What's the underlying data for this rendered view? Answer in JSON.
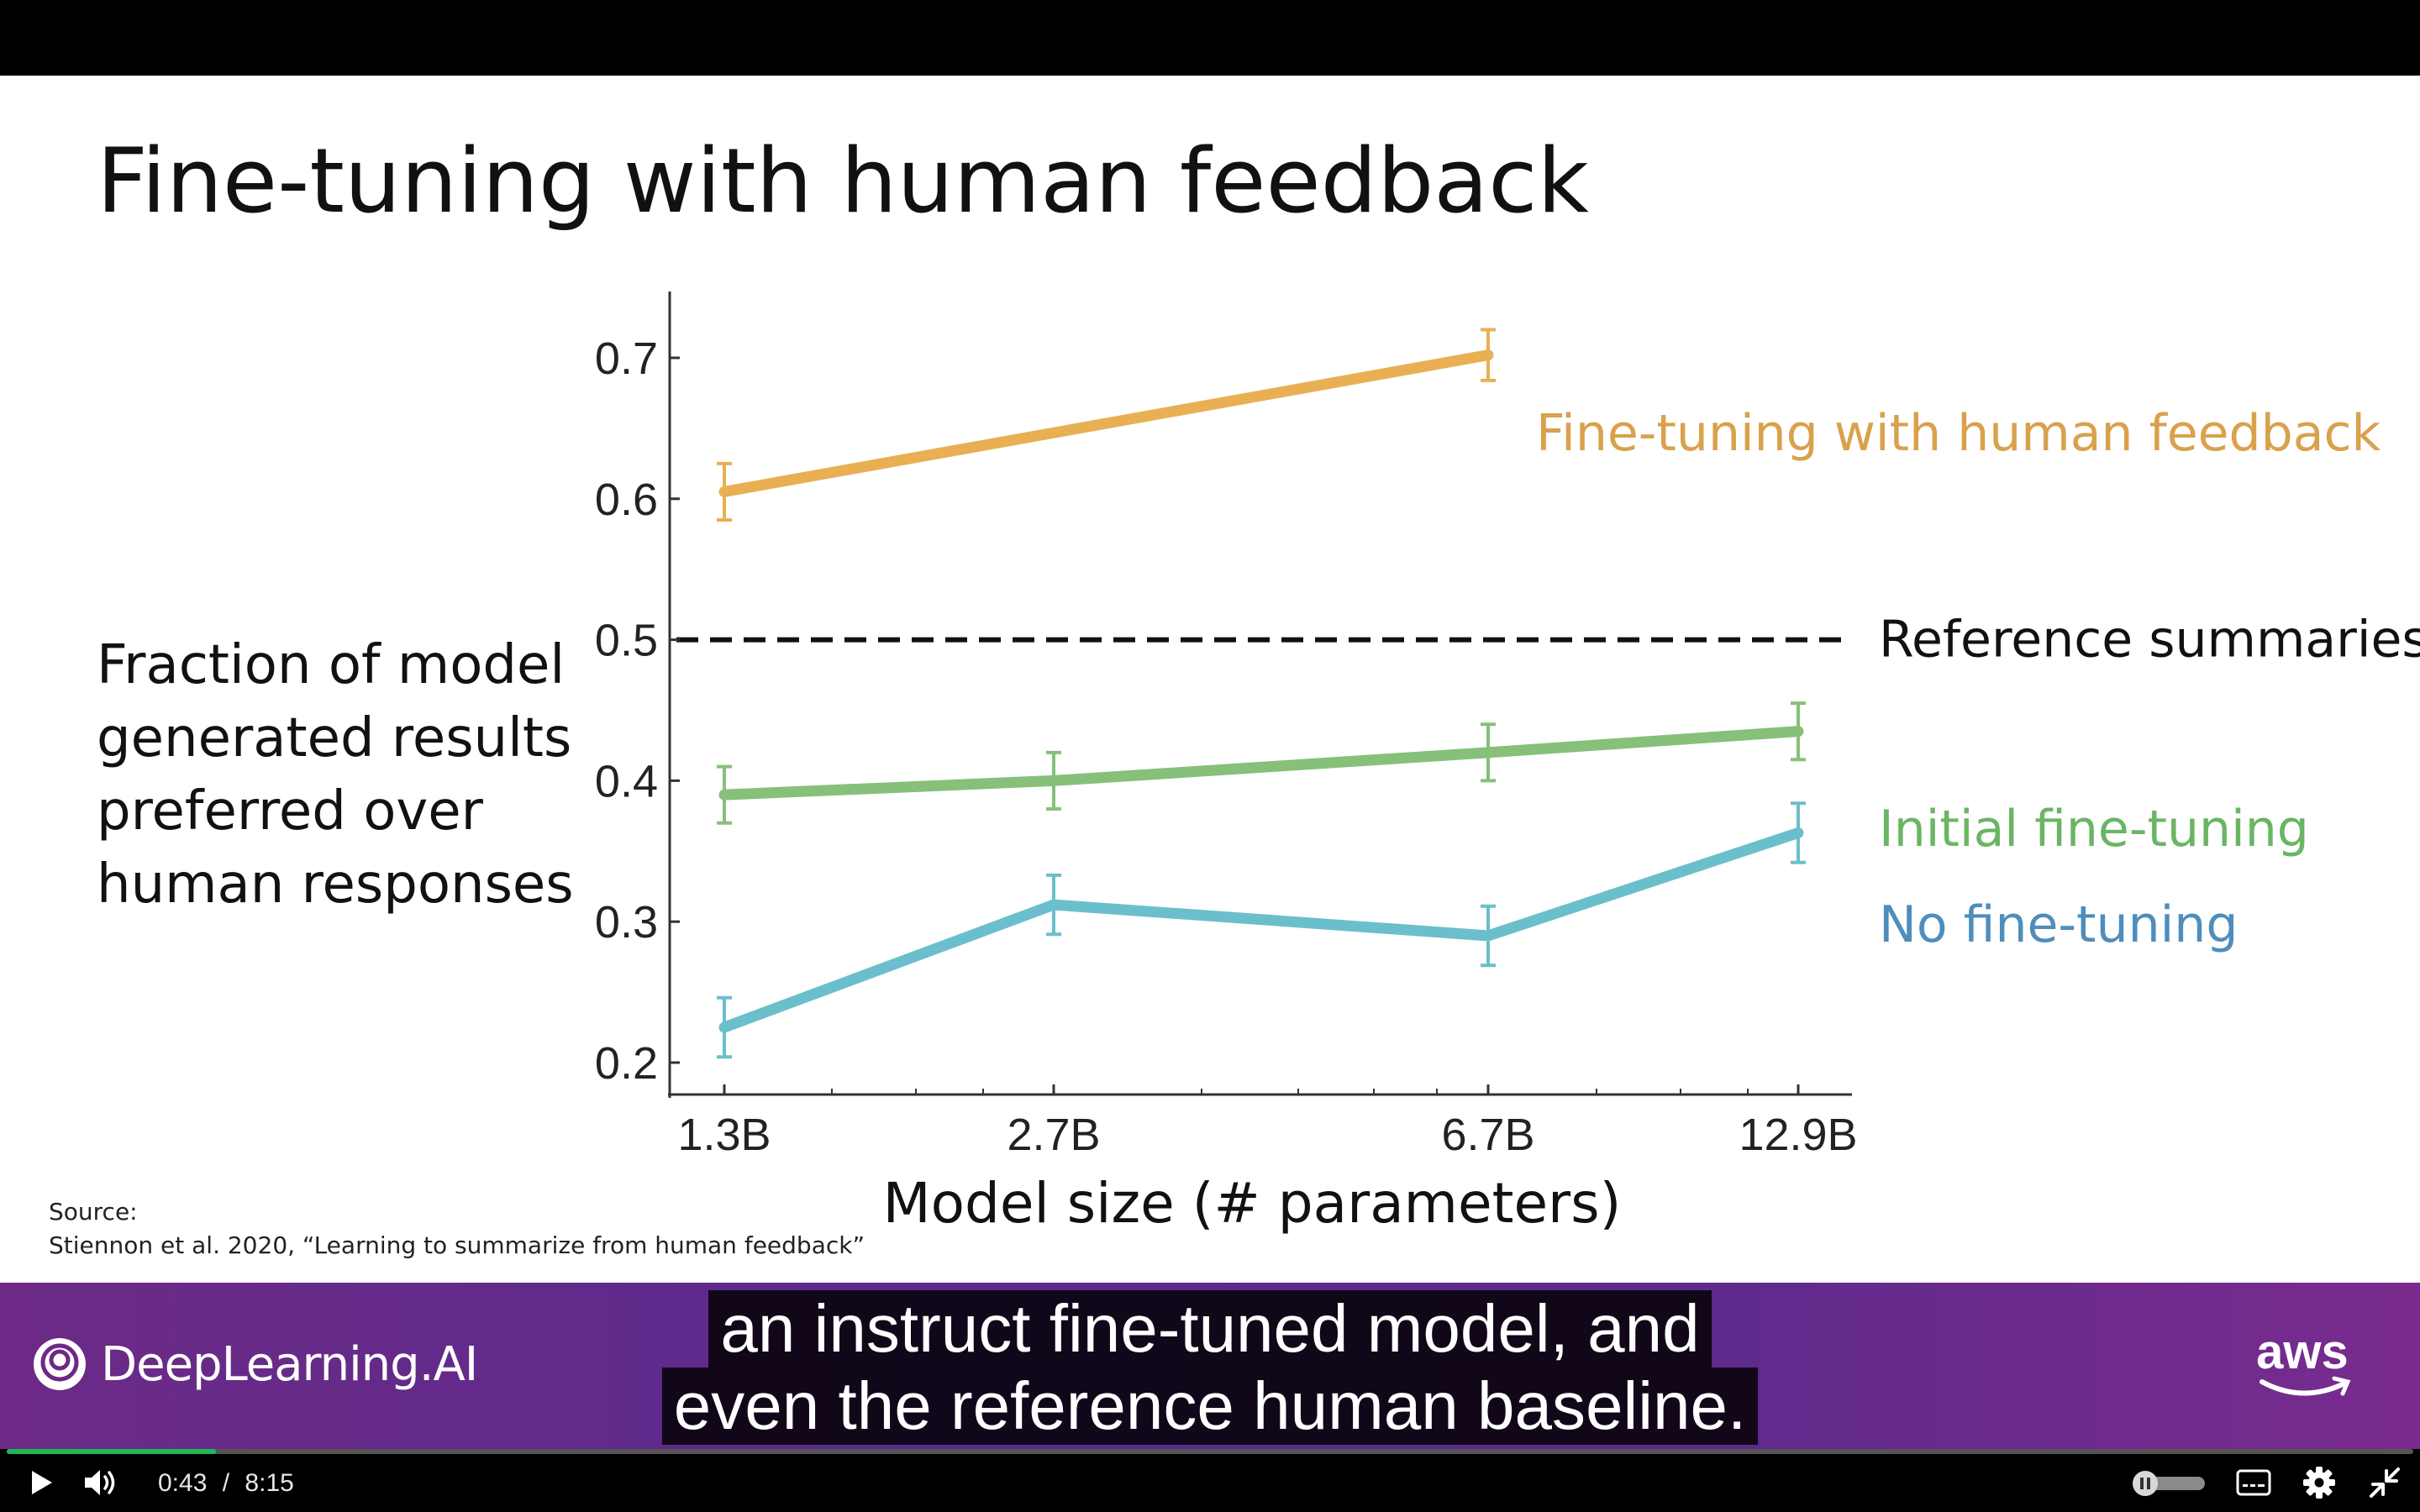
{
  "slide": {
    "title": "Fine-tuning with human feedback",
    "source_label": "Source:",
    "source_citation": "Stiennon et al. 2020, “Learning to summarize from human feedback”"
  },
  "chart_data": {
    "type": "line",
    "title": "",
    "xlabel": "Model size (# parameters)",
    "ylabel": "Fraction of model generated results preferred over human responses",
    "ylabel_lines": [
      "Fraction of model",
      "generated results",
      "preferred over",
      "human responses"
    ],
    "categories": [
      "1.3B",
      "2.7B",
      "6.7B",
      "12.9B"
    ],
    "x": [
      1.3,
      2.7,
      6.7,
      12.9
    ],
    "x_scale": "log",
    "ylim": [
      0.2,
      0.7
    ],
    "yticks": [
      "0.2",
      "0.3",
      "0.4",
      "0.5",
      "0.6",
      "0.7"
    ],
    "grid": false,
    "legend": "labels at right end of each series",
    "series": [
      {
        "name": "Fine-tuning with human feedback",
        "color": "#e8b052",
        "x": [
          1.3,
          6.7
        ],
        "values": [
          0.605,
          0.702
        ],
        "errors": [
          0.02,
          0.018
        ]
      },
      {
        "name": "Initial fine-tuning",
        "color": "#86c07b",
        "x": [
          1.3,
          2.7,
          6.7,
          12.9
        ],
        "values": [
          0.39,
          0.4,
          0.42,
          0.435
        ],
        "errors": [
          0.02,
          0.02,
          0.02,
          0.02
        ]
      },
      {
        "name": "No fine-tuning",
        "color": "#6bbfcc",
        "x": [
          1.3,
          2.7,
          6.7,
          12.9
        ],
        "values": [
          0.225,
          0.312,
          0.29,
          0.363
        ],
        "errors": [
          0.021,
          0.021,
          0.021,
          0.021
        ]
      }
    ],
    "reference": {
      "name": "Reference summaries",
      "value": 0.5,
      "color": "#111111",
      "style": "dashed"
    },
    "label_colors": {
      "Fine-tuning with human feedback": "#d9a14c",
      "Initial fine-tuning": "#6ab564",
      "No fine-tuning": "#4f8dbb",
      "Reference summaries": "#111111"
    }
  },
  "footer": {
    "brand": "DeepLearning.AI",
    "partner_logo_text": "aws",
    "brand_icon": "deeplearning-ai-logo-icon",
    "partner_icon": "aws-logo-icon"
  },
  "subtitles": {
    "line1": "an instruct fine-tuned model, and",
    "line2": "even the reference human baseline."
  },
  "player": {
    "current_time": "0:43",
    "separator": "/",
    "duration": "8:15",
    "progress_fraction": 0.087,
    "play_icon": "play-icon",
    "volume_icon": "volume-icon",
    "autoplay_icon": "autoplay-toggle-icon",
    "captions_icon": "captions-icon",
    "settings_icon": "gear-icon",
    "exit_fullscreen_icon": "exit-fullscreen-icon"
  }
}
